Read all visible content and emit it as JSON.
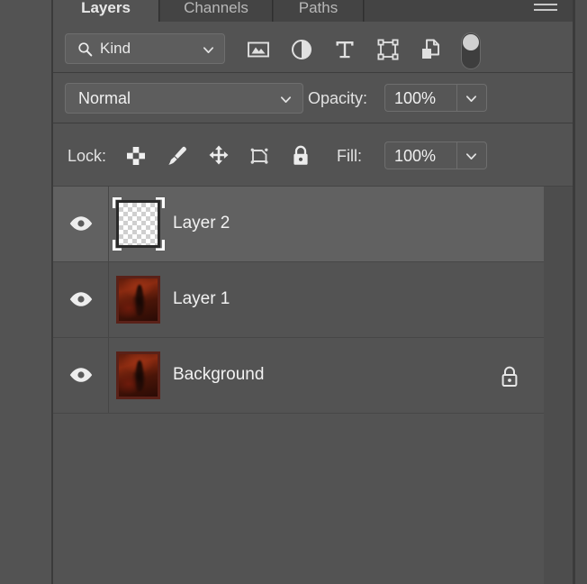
{
  "panel": {
    "title": "Layers",
    "menu_icon": "hamburger-menu-icon",
    "tabs": [
      {
        "label": "Layers",
        "active": true
      },
      {
        "label": "Channels",
        "active": false
      },
      {
        "label": "Paths",
        "active": false
      }
    ]
  },
  "filter": {
    "kind_label": "Kind",
    "search_icon": "search-icon",
    "dropdown_icon": "chevron-down-icon",
    "icons": [
      {
        "name": "pixel-layer-filter-icon",
        "title": "Filter for pixel layers"
      },
      {
        "name": "adjustment-layer-filter-icon",
        "title": "Filter for adjustment layers"
      },
      {
        "name": "type-layer-filter-icon",
        "title": "Filter for type layers"
      },
      {
        "name": "shape-layer-filter-icon",
        "title": "Filter for shape layers"
      },
      {
        "name": "smart-object-filter-icon",
        "title": "Filter for smart objects"
      }
    ],
    "toggle": {
      "name": "filter-enable-toggle",
      "state": "off"
    }
  },
  "blend": {
    "mode": "Normal",
    "dropdown_icon": "chevron-down-icon",
    "opacity_label": "Opacity:",
    "opacity_value": "100%",
    "opacity_chevron": "chevron-down-icon"
  },
  "lock": {
    "label": "Lock:",
    "icons": [
      {
        "name": "lock-transparent-pixels-icon",
        "title": "Lock transparent pixels"
      },
      {
        "name": "lock-image-pixels-icon",
        "title": "Lock image pixels"
      },
      {
        "name": "lock-position-icon",
        "title": "Lock position"
      },
      {
        "name": "lock-artboard-nesting-icon",
        "title": "Prevent auto-nesting"
      },
      {
        "name": "lock-all-icon",
        "title": "Lock all"
      }
    ],
    "fill_label": "Fill:",
    "fill_value": "100%",
    "fill_chevron": "chevron-down-icon"
  },
  "layers": [
    {
      "name": "Layer 2",
      "visible": true,
      "selected": true,
      "thumbnail": "transparent-checkerboard",
      "locked": false
    },
    {
      "name": "Layer 1",
      "visible": true,
      "selected": false,
      "thumbnail": "dark-red-artwork",
      "locked": false
    },
    {
      "name": "Background",
      "visible": true,
      "selected": false,
      "thumbnail": "dark-red-artwork",
      "locked": true,
      "lock_icon": "padlock-icon"
    }
  ],
  "colors": {
    "panel_bg": "#535353",
    "tab_inactive_bg": "#444444",
    "tab_bar_bg": "#393939",
    "row_selected_bg": "#616161",
    "field_bg": "#5d5d5d",
    "text": "#f0f0f0",
    "thumb_accent": "#8a2a10"
  }
}
